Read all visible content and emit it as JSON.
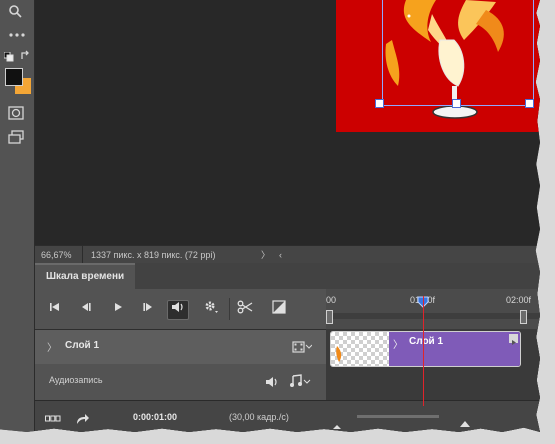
{
  "status": {
    "zoom": "66,67%",
    "doc_info": "1337 пикс. x 819 пикс. (72 ppi)",
    "expand": "〉",
    "collapse": "‹"
  },
  "timeline": {
    "tab_title": "Шкала времени",
    "ruler_labels": [
      "00",
      "01:00f",
      "02:00f"
    ],
    "layer_name": "Слой 1",
    "clip_name": "Слой 1",
    "audio_track": "Аудиозапись",
    "current_time": "0:00:01:00",
    "frame_rate": "(30,00 кадр./с)",
    "playhead_fraction": 0.5
  },
  "icons": [
    "search-icon",
    "more-icon",
    "swap-colors-icon",
    "default-colors-icon",
    "quick-mask-icon",
    "screen-mode-icon",
    "first-frame-icon",
    "prev-frame-icon",
    "play-icon",
    "next-frame-icon",
    "audio-mute-icon",
    "settings-icon",
    "split-icon",
    "transition-icon",
    "film-icon",
    "music-icon",
    "convert-frames-icon",
    "render-icon"
  ],
  "colors": {
    "artwork_bg": "#cc0000",
    "clip": "#7f5bb8",
    "playhead": "#e0242b",
    "foreground": "#111111",
    "background": "#f4a636"
  }
}
